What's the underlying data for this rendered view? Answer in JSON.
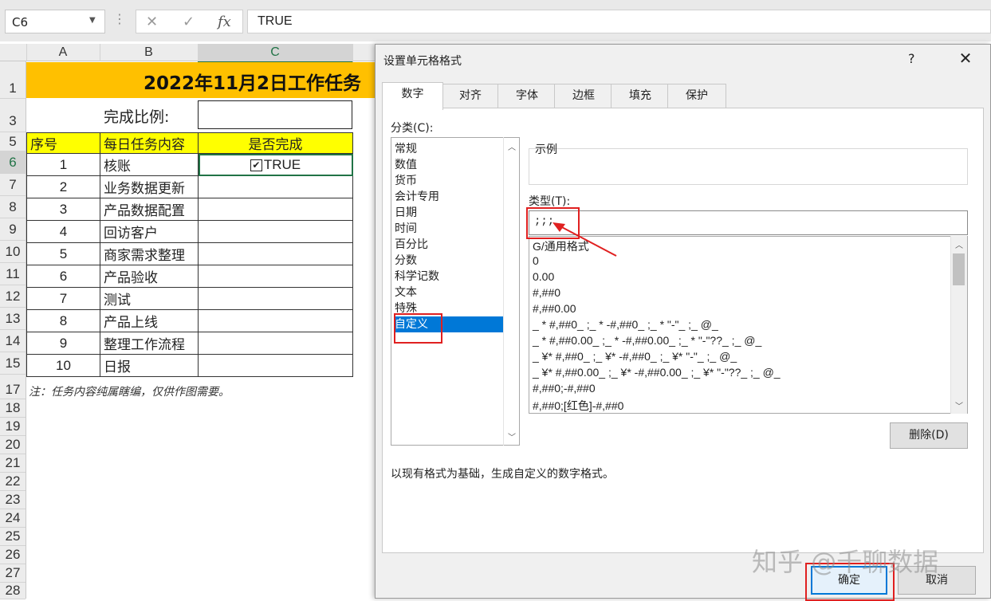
{
  "formula_bar": {
    "name_box": "C6",
    "cancel_icon": "✕",
    "enter_icon": "✓",
    "fx_icon": "fx",
    "content": "TRUE"
  },
  "columns": [
    "A",
    "B",
    "C"
  ],
  "rows": [
    "1",
    "3",
    "5",
    "6",
    "7",
    "8",
    "9",
    "10",
    "11",
    "12",
    "13",
    "14",
    "15",
    "17",
    "18",
    "19",
    "20",
    "21",
    "22",
    "23",
    "24",
    "25",
    "26",
    "27",
    "28"
  ],
  "sheet": {
    "title": "2022年11月2日工作任务",
    "ratio_label": "完成比例:",
    "headers": [
      "序号",
      "每日任务内容",
      "是否完成"
    ],
    "tasks": [
      {
        "no": "1",
        "task": "核账",
        "done": "TRUE"
      },
      {
        "no": "2",
        "task": "业务数据更新",
        "done": ""
      },
      {
        "no": "3",
        "task": "产品数据配置",
        "done": ""
      },
      {
        "no": "4",
        "task": "回访客户",
        "done": ""
      },
      {
        "no": "5",
        "task": "商家需求整理",
        "done": ""
      },
      {
        "no": "6",
        "task": "产品验收",
        "done": ""
      },
      {
        "no": "7",
        "task": "测试",
        "done": ""
      },
      {
        "no": "8",
        "task": "产品上线",
        "done": ""
      },
      {
        "no": "9",
        "task": "整理工作流程",
        "done": ""
      },
      {
        "no": "10",
        "task": "日报",
        "done": ""
      }
    ],
    "note": "注：任务内容纯属瞎编，仅供作图需要。"
  },
  "dialog": {
    "title": "设置单元格格式",
    "help": "?",
    "close": "✕",
    "tabs": [
      "数字",
      "对齐",
      "字体",
      "边框",
      "填充",
      "保护"
    ],
    "active_tab": "数字",
    "category_label": "分类(C):",
    "categories": [
      "常规",
      "数值",
      "货币",
      "会计专用",
      "日期",
      "时间",
      "百分比",
      "分数",
      "科学记数",
      "文本",
      "特殊",
      "自定义"
    ],
    "selected_category": "自定义",
    "sample_label": "示例",
    "type_label": "类型(T):",
    "type_value": ";;;",
    "formats": [
      "G/通用格式",
      "0",
      "0.00",
      "#,##0",
      "#,##0.00",
      "_ * #,##0_ ;_ * -#,##0_ ;_ * \"-\"_ ;_ @_",
      "_ * #,##0.00_ ;_ * -#,##0.00_ ;_ * \"-\"??_ ;_ @_",
      "_ ¥* #,##0_ ;_ ¥* -#,##0_ ;_ ¥* \"-\"_ ;_ @_",
      "_ ¥* #,##0.00_ ;_ ¥* -#,##0.00_ ;_ ¥* \"-\"??_ ;_ @_",
      "#,##0;-#,##0",
      "#,##0;[红色]-#,##0"
    ],
    "delete_button": "删除(D)",
    "description": "以现有格式为基础，生成自定义的数字格式。",
    "ok_button": "确定",
    "cancel_button": "取消"
  },
  "watermark": "知乎 @千聊数据",
  "colors": {
    "title_fill": "#ffc000",
    "header_fill": "#ffff00",
    "excel_green": "#217346",
    "selection_blue": "#0078d7",
    "annotation_red": "#e02020"
  }
}
